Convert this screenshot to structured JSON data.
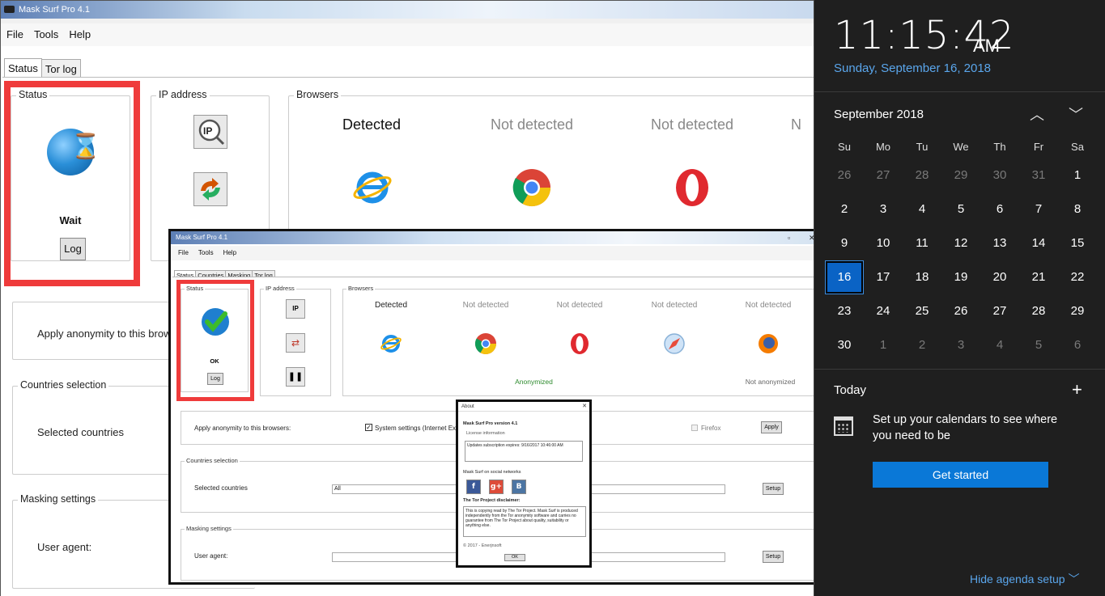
{
  "app": {
    "title": "Mask Surf Pro 4.1",
    "menu": [
      "File",
      "Tools",
      "Help"
    ],
    "tabs": [
      "Status",
      "Tor log"
    ],
    "status": {
      "group_title": "Status",
      "state": "Wait",
      "log_button": "Log"
    },
    "ip_group_title": "IP address",
    "browsers_group_title": "Browsers",
    "browsers": [
      {
        "status": "Detected",
        "icon": "internet-explorer-icon"
      },
      {
        "status": "Not detected",
        "icon": "chrome-icon"
      },
      {
        "status": "Not detected",
        "icon": "opera-icon"
      },
      {
        "status": "N",
        "icon": ""
      }
    ],
    "apply_label": "Apply anonymity to this browse",
    "countries_group_title": "Countries selection",
    "selected_countries_label": "Selected countries",
    "masking_group_title": "Masking settings",
    "user_agent_label": "User agent:"
  },
  "inner": {
    "title": "Mask Surf Pro 4.1",
    "menu": [
      "File",
      "Tools",
      "Help"
    ],
    "tabs": [
      "Status",
      "Countries",
      "Masking",
      "Tor log"
    ],
    "status": {
      "group_title": "Status",
      "state": "OK",
      "log_button": "Log"
    },
    "ip_group_title": "IP address",
    "browsers_group_title": "Browsers",
    "browsers": [
      {
        "status": "Detected",
        "note": "",
        "icon": "internet-explorer-icon"
      },
      {
        "status": "Not detected",
        "note": "Anonymized",
        "icon": "chrome-icon"
      },
      {
        "status": "Not detected",
        "note": "",
        "icon": "opera-icon"
      },
      {
        "status": "Not detected",
        "note": "",
        "icon": "safari-icon"
      },
      {
        "status": "Not detected",
        "note": "Not anonymized",
        "icon": "firefox-icon"
      }
    ],
    "apply_label": "Apply anonymity to this browsers:",
    "system_settings_label": "System settings (Internet Explore",
    "firefox_label": "Firefox",
    "apply_button": "Apply",
    "countries_group_title": "Countries selection",
    "selected_countries_label": "Selected countries",
    "selected_countries_value": "All",
    "setup_button": "Setup",
    "masking_group_title": "Masking settings",
    "user_agent_label": "User agent:",
    "user_agent_setup_button": "Setup"
  },
  "about": {
    "title": "About",
    "version": "Mask Surf Pro version 4.1",
    "license_label": "License information",
    "license_text": "Updates subscription expires: 9/16/2017 10:46:00 AM",
    "social_label": "Mask Surf on social networks",
    "social": [
      "f",
      "g+",
      "B"
    ],
    "disclaimer_title": "The Tor Project disclaimer:",
    "disclaimer_text": "This is copying read by The Tor Project. Mask Surf is produced independently from the Tor anonymity software and carries no guarantee from The Tor Project about quality, suitability or anything else.",
    "footer": "© 2017 - Enerjnsoft",
    "ok_button": "OK"
  },
  "flyout": {
    "time": "11:15:42",
    "ampm": "AM",
    "date": "Sunday, September 16, 2018",
    "month_title": "September 2018",
    "days_of_week": [
      "Su",
      "Mo",
      "Tu",
      "We",
      "Th",
      "Fr",
      "Sa"
    ],
    "weeks": [
      [
        "26",
        "27",
        "28",
        "29",
        "30",
        "31",
        "1"
      ],
      [
        "2",
        "3",
        "4",
        "5",
        "6",
        "7",
        "8"
      ],
      [
        "9",
        "10",
        "11",
        "12",
        "13",
        "14",
        "15"
      ],
      [
        "16",
        "17",
        "18",
        "19",
        "20",
        "21",
        "22"
      ],
      [
        "23",
        "24",
        "25",
        "26",
        "27",
        "28",
        "29"
      ],
      [
        "30",
        "1",
        "2",
        "3",
        "4",
        "5",
        "6"
      ]
    ],
    "selected_day": "16",
    "today_title": "Today",
    "setup_text": "Set up your calendars to see where you need to be",
    "get_started": "Get started",
    "hide_agenda": "Hide agenda setup"
  },
  "colors": {
    "accent": "#0a78d7",
    "highlight_box": "#ef3b3b",
    "flyout_bg": "#1f1f1f",
    "link": "#5aa6ec"
  }
}
